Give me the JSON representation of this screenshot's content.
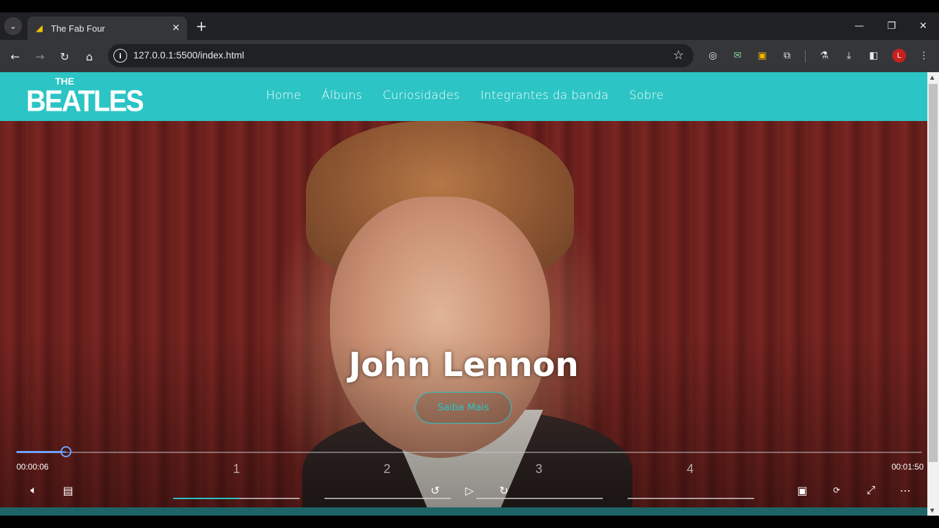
{
  "browser": {
    "tab_title": "The Fab Four",
    "url": "127.0.0.1:5500/index.html",
    "profile_initial": "L"
  },
  "site": {
    "logo_the": "THE",
    "logo_main": "BEATLES",
    "nav": [
      "Home",
      "Álbuns",
      "Curiosidades",
      "Integrantes da banda",
      "Sobre"
    ],
    "hero_title": "John Lennon",
    "hero_button": "Saiba Mais",
    "accent_color": "#2cc4c4"
  },
  "player": {
    "current_time": "00:00:06",
    "total_time": "00:01:50",
    "progress_fraction": 0.0545,
    "chapters": [
      "1",
      "2",
      "3",
      "4"
    ],
    "seek_color": "#6ea3ff",
    "icons": [
      "volume-icon",
      "captions-icon",
      "rewind-10-icon",
      "play-icon",
      "forward-30-icon",
      "miniplayer-icon",
      "360-icon",
      "exit-fullscreen-icon",
      "more-icon"
    ]
  }
}
